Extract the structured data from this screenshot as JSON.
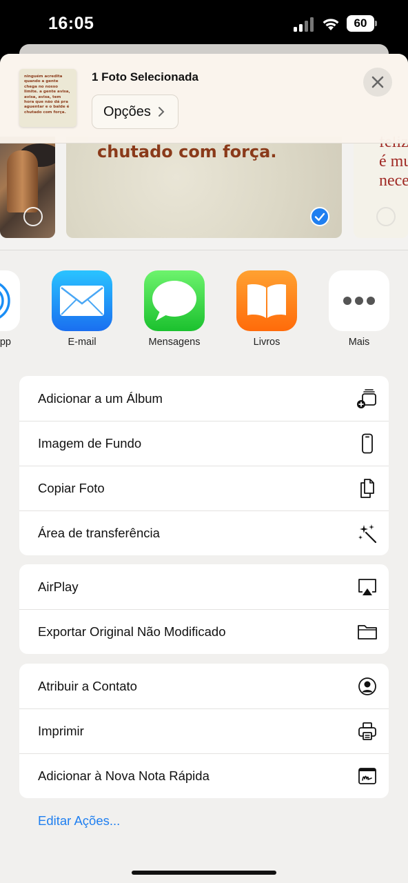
{
  "status_bar": {
    "time": "16:05",
    "battery": "60"
  },
  "header": {
    "title": "1 Foto Selecionada",
    "options_label": "Opções",
    "thumbnail_text": "ninguém acredita quando a gente chega no nosso limite. a gente avisa, avisa, avisa, tem hora que não dá pra aguentar e o balde é chutado com força."
  },
  "photos": {
    "center_text": "chutado com força.",
    "right_text_lines": [
      "feliz",
      "é mu",
      "nece"
    ]
  },
  "apps": [
    {
      "label": "pp",
      "icon": "airdrop-icon"
    },
    {
      "label": "E-mail",
      "icon": "mail-icon"
    },
    {
      "label": "Mensagens",
      "icon": "messages-icon"
    },
    {
      "label": "Livros",
      "icon": "books-icon"
    },
    {
      "label": "Mais",
      "icon": "more-icon"
    }
  ],
  "groups": [
    [
      {
        "label": "Adicionar a um Álbum",
        "icon": "add-to-album-icon"
      },
      {
        "label": "Imagem de Fundo",
        "icon": "phone-icon"
      },
      {
        "label": "Copiar Foto",
        "icon": "copy-icon"
      },
      {
        "label": "Área de transferência",
        "icon": "sparkles-icon"
      }
    ],
    [
      {
        "label": "AirPlay",
        "icon": "airplay-icon"
      },
      {
        "label": "Exportar Original Não Modificado",
        "icon": "folder-icon"
      }
    ],
    [
      {
        "label": "Atribuir a Contato",
        "icon": "contact-icon"
      },
      {
        "label": "Imprimir",
        "icon": "printer-icon"
      },
      {
        "label": "Adicionar à Nova Nota Rápida",
        "icon": "quick-note-icon"
      }
    ]
  ],
  "edit_actions_label": "Editar Ações...",
  "colors": {
    "accent": "#1f7ff0",
    "sheet_bg": "#f1f0ee"
  }
}
